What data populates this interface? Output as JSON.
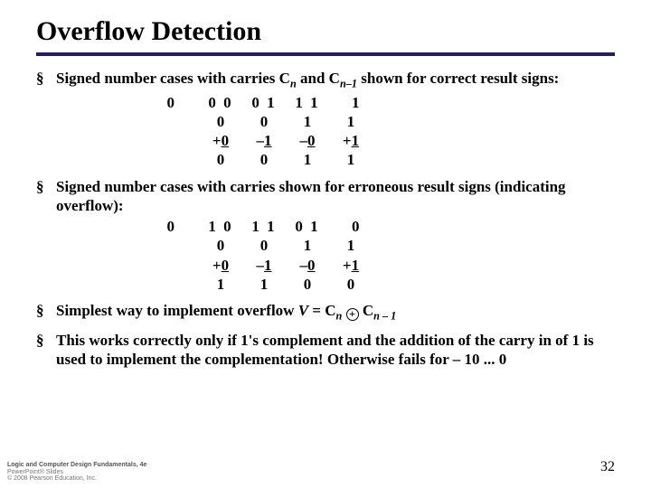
{
  "title": "Overflow Detection",
  "bullet1_a": "Signed number cases with carries ",
  "bullet1_c": " and ",
  "bullet1_e": " shown for correct result signs:",
  "Cvar": "C",
  "sub_n": "n",
  "sub_nm1": "n–1",
  "tableA": {
    "carries": [
      "0  ",
      "0 0",
      "0 1",
      "1 1",
      "  1"
    ],
    "op1": [
      "",
      "0",
      "0",
      "1",
      "1"
    ],
    "op2sign": [
      "",
      "+",
      "–",
      "–",
      "+"
    ],
    "op2val": [
      "",
      "0",
      "1",
      "0",
      "1"
    ],
    "sum": [
      "",
      "0",
      "0",
      "1",
      "1"
    ]
  },
  "bullet2": "Signed number cases with carries shown for erroneous result signs (indicating overflow):",
  "tableB": {
    "carries": [
      "0  ",
      "1 0",
      "1 1",
      "0 1",
      "  0"
    ],
    "op1": [
      "",
      "0",
      "0",
      "1",
      "1"
    ],
    "op2sign": [
      "",
      "+",
      "–",
      "–",
      "+"
    ],
    "op2val": [
      "",
      "0",
      "1",
      "0",
      "1"
    ],
    "sum": [
      "",
      "1",
      "1",
      "0",
      "0"
    ]
  },
  "bullet3_a": "Simplest way to implement overflow ",
  "bullet3_V": "V",
  "bullet3_eq": " = ",
  "bullet3_C1": "C",
  "bullet3_C2": "C",
  "bullet3_sub1": "n",
  "bullet3_sub2": "n – 1",
  "bullet4": "This works correctly only if 1's complement and the addition of the carry in of 1 is used to implement the complementation! Otherwise fails for – 10 ... 0",
  "footer": {
    "l1": "Logic and Computer Design Fundamentals, 4e",
    "l2": "PowerPoint® Slides",
    "l3": "© 2008 Pearson Education, Inc."
  },
  "page": "32"
}
